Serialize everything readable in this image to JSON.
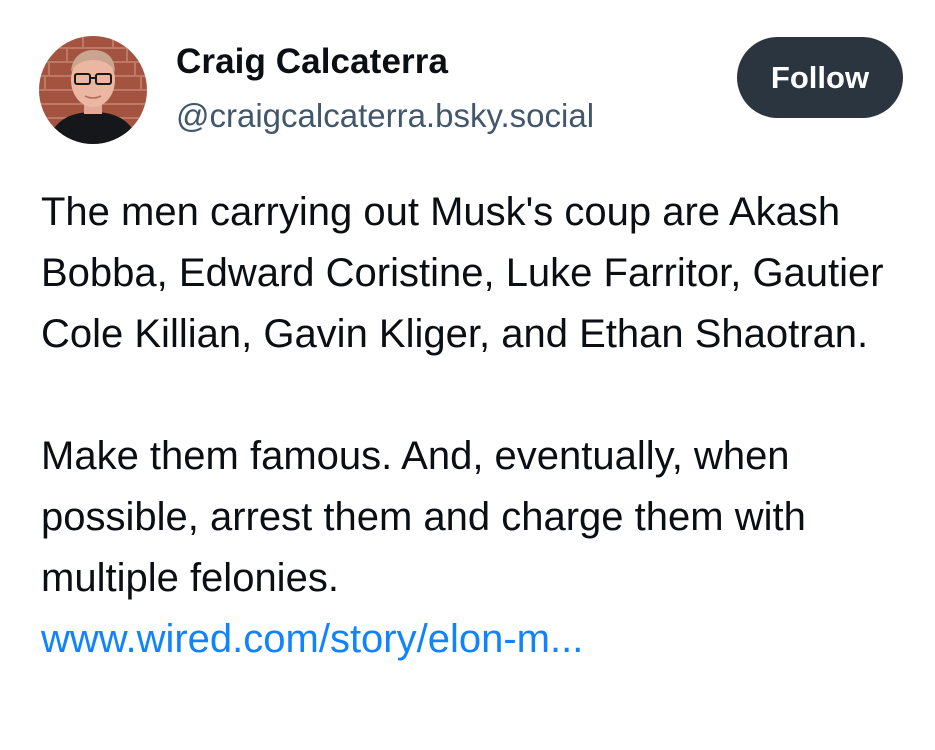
{
  "author": {
    "name": "Craig Calcaterra",
    "handle": "@craigcalcaterra.bsky.social",
    "avatar_icon": "profile-photo"
  },
  "follow_label": "Follow",
  "post": {
    "paragraph1": "The men carrying out Musk's coup are Akash Bobba, Edward Coristine, Luke Farritor, Gautier Cole Killian, Gavin Kliger, and Ethan Shaotran.",
    "paragraph2": "Make them famous. And, eventually, when possible, arrest them and charge them with multiple felonies.",
    "link_text": "www.wired.com/story/elon-m..."
  },
  "colors": {
    "follow_bg": "#2b3540",
    "handle": "#42576c",
    "link": "#1083fe",
    "text": "#0b0f14"
  }
}
